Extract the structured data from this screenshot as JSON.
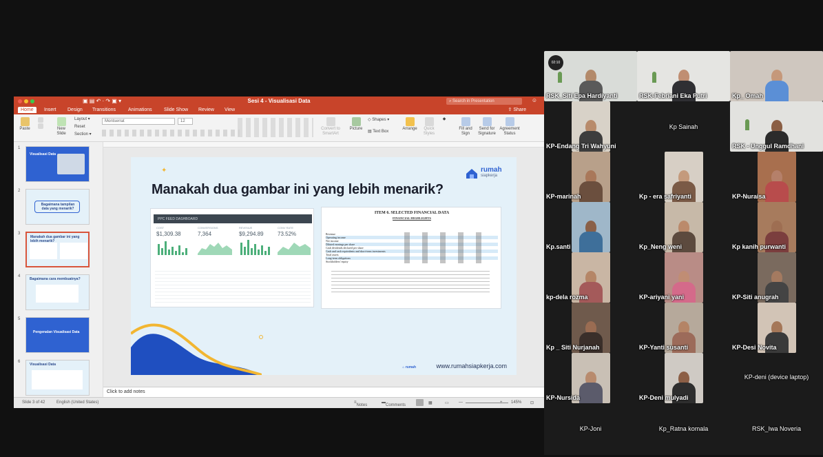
{
  "ppt": {
    "window_title": "Sesi 4 - Visualisasi Data",
    "search_placeholder": "Search in Presentation",
    "tabs": [
      "Home",
      "Insert",
      "Design",
      "Transitions",
      "Animations",
      "Slide Show",
      "Review",
      "View"
    ],
    "active_tab": "Home",
    "share_label": "Share",
    "ribbon": {
      "paste": "Paste",
      "new_slide": "New\nSlide",
      "layout": "Layout",
      "reset": "Reset",
      "section": "Section",
      "font_name": "Montserrat",
      "font_size": "12",
      "convert": "Convert to\nSmartArt",
      "picture": "Picture",
      "shapes": "Shapes",
      "text_box": "Text Box",
      "arrange": "Arrange",
      "quick_styles": "Quick\nStyles",
      "fill_sign": "Fill and\nSign",
      "send_signature": "Send for\nSignature",
      "agreement_status": "Agreement\nStatus"
    },
    "thumbnails": [
      {
        "num": "1",
        "title": "Visualisasi Data",
        "style": "dark"
      },
      {
        "num": "2",
        "title": "Bagaimana tampilan data yang menarik?",
        "style": "light"
      },
      {
        "num": "3",
        "title": "Manakah dua gambar ini yang lebih menarik?",
        "style": "light"
      },
      {
        "num": "4",
        "title": "Bagaimana cara membuatnya?",
        "style": "light"
      },
      {
        "num": "5",
        "title": "Pengenalan Visualisasi Data",
        "style": "dark"
      },
      {
        "num": "6",
        "title": "Visualisasi Data",
        "style": "light"
      }
    ],
    "notes_placeholder": "Click to add notes",
    "status": {
      "slide_counter": "Slide 3 of 42",
      "language": "English (United States)",
      "notes_btn": "Notes",
      "comments_btn": "Comments",
      "zoom": "145%"
    }
  },
  "slide": {
    "title": "Manakah dua gambar ini yang lebih menarik?",
    "brand_name": "rumah",
    "brand_sub": "siapkerja",
    "footer_url": "www.rumahsiapkerja.com",
    "dashboard": {
      "header": "PPC FEED DASHBOARD",
      "kpis": [
        {
          "label": "COST",
          "value": "$1,309.38"
        },
        {
          "label": "CONVERSIONS",
          "value": "7,364"
        },
        {
          "label": "REVENUE",
          "value": "$9,294.89"
        },
        {
          "label": "CONV RATE",
          "value": "73.52%"
        }
      ]
    },
    "financial": {
      "title": "ITEM 6. SELECTED FINANCIAL DATA",
      "subtitle": "FINANCIAL HIGHLIGHTS",
      "rows": [
        "Revenue",
        "Operating income",
        "Net income",
        "Diluted earnings per share",
        "Cash dividends declared per share",
        "Cash and cash equivalents and short-term investments",
        "Total assets",
        "Long-term obligations",
        "Stockholders' equity"
      ]
    }
  },
  "participants": [
    {
      "name": "RSK_Siti Epa Hardiyanti",
      "video": true,
      "timer": "02:10"
    },
    {
      "name": "RSK-Febriani Eka Putri",
      "video": true
    },
    {
      "name": "Kp_ Omah",
      "video": true
    },
    {
      "name": "KP-Endang Tri Wahyuni",
      "video": true
    },
    {
      "name": "Kp Sainah",
      "video": false
    },
    {
      "name": "RSK - Unggul Ramdhani",
      "video": true
    },
    {
      "name": "KP-marinah",
      "video": true
    },
    {
      "name": "Kp - era safriyanti",
      "video": true
    },
    {
      "name": "KP-Nuraisa",
      "video": true
    },
    {
      "name": "Kp.santi",
      "video": true
    },
    {
      "name": "Kp_Neng weni",
      "video": true
    },
    {
      "name": "Kp kanih purwanti",
      "video": true
    },
    {
      "name": "kp-dela rozma",
      "video": true
    },
    {
      "name": "KP-ariyani yani",
      "video": true
    },
    {
      "name": "KP-Siti anugrah",
      "video": true
    },
    {
      "name": "Kp _ Siti Nurjanah",
      "video": true
    },
    {
      "name": "KP-Yanti susanti",
      "video": true
    },
    {
      "name": "KP-Desi Novita",
      "video": true
    },
    {
      "name": "KP-Nursida",
      "video": true
    },
    {
      "name": "KP-Deni mulyadi",
      "video": true
    },
    {
      "name": "KP-deni (device laptop)",
      "video": false
    },
    {
      "name": "KP-Joni",
      "video": false
    },
    {
      "name": "Kp_Ratna komala",
      "video": false
    },
    {
      "name": "RSK_Iwa Noveria",
      "video": false
    }
  ],
  "colors": {
    "ppt_accent": "#c8442a",
    "slide_bg": "#e4f1f9",
    "brand_blue": "#2f62d1",
    "chart_green": "#4caf7a"
  }
}
